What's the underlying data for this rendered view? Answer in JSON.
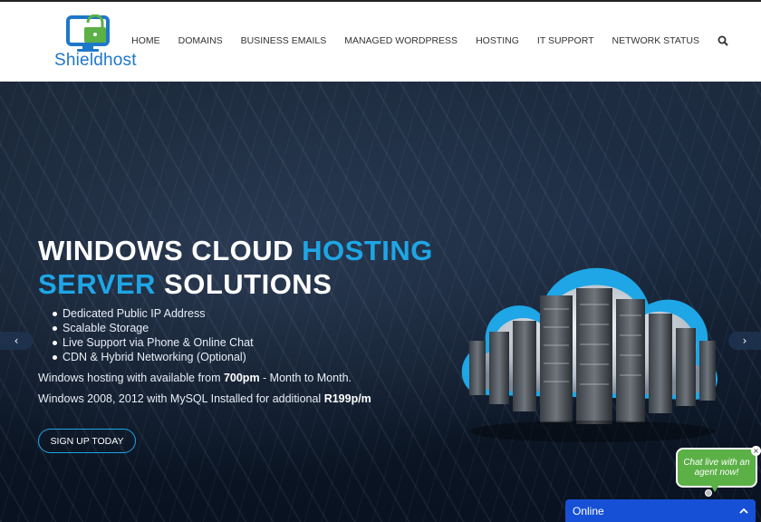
{
  "brand": {
    "name": "Shieldhost",
    "primary_color": "#1e78c8",
    "accent_color": "#5bb046"
  },
  "nav": {
    "items": [
      "HOME",
      "DOMAINS",
      "BUSINESS EMAILS",
      "MANAGED WORDPRESS",
      "HOSTING",
      "IT SUPPORT",
      "NETWORK STATUS"
    ],
    "search_icon": "search-icon"
  },
  "hero": {
    "title_part1": "WINDOWS CLOUD ",
    "title_hl1": "HOSTING",
    "title_hl2": "SERVER",
    "title_part2": " SOLUTIONS",
    "bullets": [
      "Dedicated Public IP Address",
      "Scalable Storage",
      "Live Support via Phone & Online Chat",
      "CDN & Hybrid Networking (Optional)"
    ],
    "line1_pre": "Windows hosting with available from ",
    "line1_bold": "700pm",
    "line1_post": " - Month to Month.",
    "line2_pre": "Windows 2008, 2012 with MySQL Installed for additional ",
    "line2_bold": "R199p/m",
    "cta_label": "SIGN UP TODAY",
    "highlight_color": "#1ea6e6",
    "prev_arrow": "‹",
    "next_arrow": "›"
  },
  "chat": {
    "bubble_text": "Chat live with an agent now!",
    "close_glyph": "×",
    "status": "Online",
    "bar_color": "#1650d6"
  }
}
